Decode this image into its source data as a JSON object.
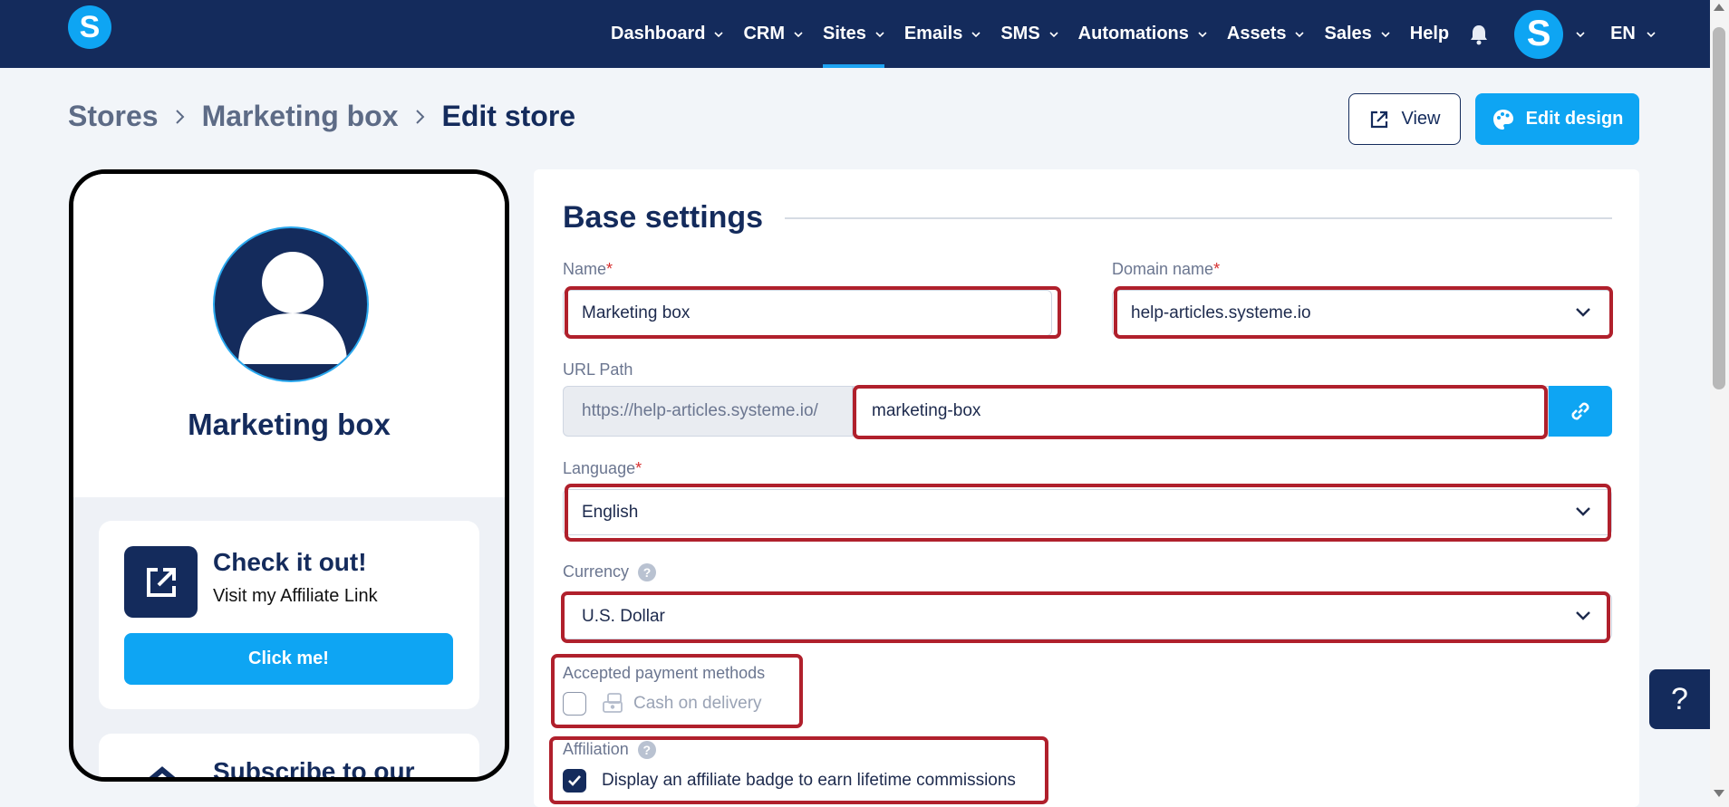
{
  "nav": {
    "logo": "S",
    "items": [
      {
        "label": "Dashboard",
        "active": false
      },
      {
        "label": "CRM",
        "active": false
      },
      {
        "label": "Sites",
        "active": true
      },
      {
        "label": "Emails",
        "active": false
      },
      {
        "label": "SMS",
        "active": false
      },
      {
        "label": "Automations",
        "active": false
      },
      {
        "label": "Assets",
        "active": false
      },
      {
        "label": "Sales",
        "active": false
      }
    ],
    "help": "Help",
    "user_initial": "S",
    "language": "EN"
  },
  "breadcrumb": {
    "stores": "Stores",
    "store": "Marketing box",
    "current": "Edit store"
  },
  "actions": {
    "view": "View",
    "edit_design": "Edit design"
  },
  "preview": {
    "profile_name": "Marketing box",
    "card_title": "Check it out!",
    "card_subtitle": "Visit my Affiliate Link",
    "card_button": "Click me!",
    "card2_title": "Subscribe to our"
  },
  "form": {
    "section_title": "Base settings",
    "name_label": "Name",
    "name_value": "Marketing box",
    "domain_label": "Domain name",
    "domain_value": "help-articles.systeme.io",
    "url_label": "URL Path",
    "url_prefix": "https://help-articles.systeme.io/",
    "url_value": "marketing-box",
    "language_label": "Language",
    "language_value": "English",
    "currency_label": "Currency",
    "currency_value": "U.S. Dollar",
    "payment_label": "Accepted payment methods",
    "payment_option": "Cash on delivery",
    "payment_checked": false,
    "affiliation_label": "Affiliation",
    "affiliation_option": "Display an affiliate badge to earn lifetime commissions",
    "affiliation_checked": true,
    "required_mark": "*"
  },
  "help_widget": "?",
  "colors": {
    "nav_bg": "#142b5c",
    "accent": "#0ea5f3",
    "highlight": "#b0202c"
  }
}
